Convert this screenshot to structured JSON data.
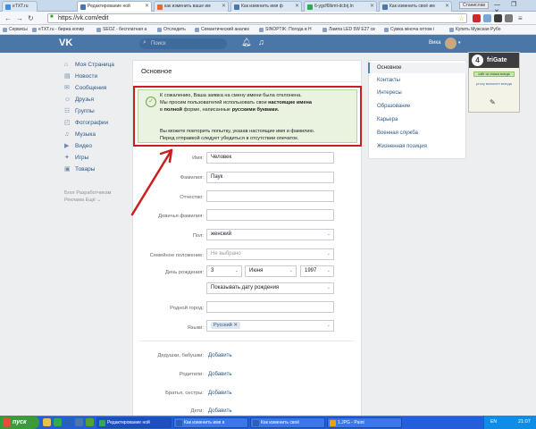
{
  "browser": {
    "tabs": [
      {
        "label": "eTXT.ru",
        "color": "#3a8ee6"
      },
      {
        "label": "Редактирование ной",
        "color": "#4a76a8"
      },
      {
        "label": "как изменить ваше им",
        "color": "#e36b2c"
      },
      {
        "label": "Как изменить имя ф",
        "color": "#4a76a8"
      },
      {
        "label": "6-ygcf6lbmt-dcbrj.ln",
        "color": "#35a853"
      },
      {
        "label": "Как изменить своё им",
        "color": "#4a76a8"
      }
    ],
    "profile_badge": "Станислав",
    "window_buttons": "— ❐ ✕",
    "url": "https://vk.com/edit",
    "bookmarks": [
      "Сервисы",
      "eTXT.ru - биржа копир",
      "SEOZ - бесплатная а",
      "Отследить",
      "Семантический анализ",
      "SINOPTIK: Погода в Н",
      "Лампа LED 5W E27 св",
      "Сумка жіноча оптом і",
      "Купить Мужская Рубо"
    ]
  },
  "vk": {
    "logo": "VK",
    "search_placeholder": "Поиск",
    "user_name": "Вика",
    "left_menu": [
      {
        "label": "Моя Страница",
        "icon": "⌂"
      },
      {
        "label": "Новости",
        "icon": "▤"
      },
      {
        "label": "Сообщения",
        "icon": "✉"
      },
      {
        "label": "Друзья",
        "icon": "☺"
      },
      {
        "label": "Группы",
        "icon": "☷"
      },
      {
        "label": "Фотографии",
        "icon": "◰"
      },
      {
        "label": "Музыка",
        "icon": "♫"
      },
      {
        "label": "Видео",
        "icon": "▶"
      },
      {
        "label": "Игры",
        "icon": "✦"
      },
      {
        "label": "Товары",
        "icon": "▣"
      }
    ],
    "footer_links": "Блог  Разработчикам  Реклама  Ещё ⌄"
  },
  "edit": {
    "title": "Основное",
    "notice_line1": "К сожалению, Ваша заявка на смену имени была отклонена.",
    "notice_line2a": "Мы просим пользователей использовать свои",
    "notice_line2b": "настоящие имена",
    "notice_line3a": "в",
    "notice_line3b": "полной",
    "notice_line3c": "форме, написанные",
    "notice_line3d": "русскими буквами.",
    "notice_line4": "Вы можете повторить попытку, указав настоящие имя и фамилию.",
    "notice_line5": "Перед отправкой следует убедиться в отсутствии опечаток.",
    "fields": {
      "first_name": {
        "label": "Имя:",
        "value": "Человек"
      },
      "last_name": {
        "label": "Фамилия:",
        "value": "Паук"
      },
      "patronymic": {
        "label": "Отчество:",
        "value": ""
      },
      "maiden_name": {
        "label": "Девичья фамилия:",
        "value": ""
      },
      "sex": {
        "label": "Пол:",
        "value": "женский"
      },
      "family_status": {
        "label": "Семейное положение:",
        "value": "Не выбрано"
      },
      "birthday": {
        "label": "День рождения:",
        "day": "3",
        "month": "Июня",
        "year": "1997",
        "visibility": "Показывать дату рождения"
      },
      "hometown": {
        "label": "Родной город:",
        "value": ""
      },
      "languages": {
        "label": "Языки:",
        "tag": "Русский"
      }
    },
    "relatives": [
      {
        "label": "Дедушки, бабушки:",
        "action": "Добавить"
      },
      {
        "label": "Родители:",
        "action": "Добавить"
      },
      {
        "label": "Братья, сестры:",
        "action": "Добавить"
      },
      {
        "label": "Дети:",
        "action": "Добавить"
      }
    ]
  },
  "right_menu": [
    "Основное",
    "Контакты",
    "Интересы",
    "Образование",
    "Карьера",
    "Военная служба",
    "Жизненная позиция"
  ],
  "frigate": {
    "name": "friGate",
    "status": "сайт из списка всегда",
    "note": "proxy включен всегда"
  },
  "taskbar": {
    "start": "пуск",
    "tasks": [
      {
        "label": "Редактирование ной",
        "color": "#35a853"
      },
      {
        "label": "Как изменить имя в",
        "color": "#2b5fb8"
      },
      {
        "label": "Как изменить своё",
        "color": "#2b5fb8"
      },
      {
        "label": "1.JPG - Paint",
        "color": "#e6a21e"
      }
    ],
    "lang": "EN",
    "clock": "21:07"
  }
}
